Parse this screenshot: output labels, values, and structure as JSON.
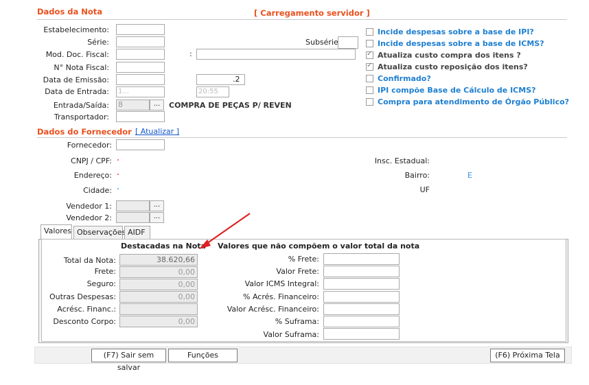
{
  "dados_nota": {
    "title": "Dados da Nota",
    "server_link": "[ Carregamento servidor ]",
    "labels": {
      "estabelecimento": "Estabelecimento:",
      "serie": "Série:",
      "subserie": "Subsérie:",
      "mod_doc": "Mod. Doc. Fiscal:",
      "nota_fiscal": "N° Nota Fiscal:",
      "data_emissao": "Data de Emissão:",
      "data_entrada": "Data de Entrada:",
      "entrada_saida": "Entrada/Saída:",
      "transportador": "Transportador:"
    },
    "values": {
      "mod_doc_sep": ":",
      "data_emissao_tail": ".2",
      "data_entrada_partial": "1...",
      "hora_entrada_partial": "20:55",
      "entrada_saida_code": "8",
      "cfop_desc": "COMPRA DE PEÇAS P/ REVEN"
    },
    "lookup_btn": "..."
  },
  "options": [
    {
      "label": "Incide despesas sobre a base de IPI?",
      "checked": false,
      "style": "blue"
    },
    {
      "label": "Incide despesas sobre a base de ICMS?",
      "checked": false,
      "style": "blue"
    },
    {
      "label": "Atualiza custo compra dos itens ?",
      "checked": true,
      "style": "dark"
    },
    {
      "label": "Atualiza custo reposição dos itens?",
      "checked": true,
      "style": "dark"
    },
    {
      "label": "Confirmado?",
      "checked": false,
      "style": "blue"
    },
    {
      "label": "IPI compõe Base de Cálculo de ICMS?",
      "checked": false,
      "style": "blue"
    },
    {
      "label": "Compra para atendimento de Órgão Público?",
      "checked": false,
      "style": "blue"
    }
  ],
  "fornecedor": {
    "title": "Dados do Fornecedor",
    "update_link": "[ Atualizar ]",
    "labels": {
      "fornecedor": "Fornecedor:",
      "cnpj": "CNPJ / CPF:",
      "endereco": "Endereço:",
      "cidade": "Cidade:",
      "vendedor1": "Vendedor 1:",
      "vendedor2": "Vendedor 2:",
      "insc_estadual": "Insc. Estadual:",
      "bairro": "Bairro:",
      "uf": "UF"
    },
    "values": {
      "bairro_tail": "E"
    }
  },
  "tabs": [
    "Valores",
    "Observações",
    "AIDF"
  ],
  "valores": {
    "destacadas_title": "Destacadas na Nota",
    "nao_compoem_title": "Valores que não compõem o valor total da nota",
    "left": [
      {
        "label": "Total da Nota:",
        "value": "38.620,66"
      },
      {
        "label": "Frete:",
        "value": "0,00"
      },
      {
        "label": "Seguro:",
        "value": "0,00"
      },
      {
        "label": "Outras Despesas:",
        "value": "0,00"
      },
      {
        "label": "Acrésc. Financ.:",
        "value": ""
      },
      {
        "label": "Desconto Corpo:",
        "value": "0,00"
      }
    ],
    "right": [
      {
        "label": "% Frete:",
        "value": ""
      },
      {
        "label": "Valor Frete:",
        "value": ""
      },
      {
        "label": "Valor ICMS Integral:",
        "value": ""
      },
      {
        "label": "% Acrés. Financeiro:",
        "value": ""
      },
      {
        "label": "Valor Acrésc. Financeiro:",
        "value": ""
      },
      {
        "label": "% Suframa:",
        "value": ""
      },
      {
        "label": "Valor Suframa:",
        "value": ""
      }
    ]
  },
  "footer": {
    "sair": "(F7) Sair sem salvar",
    "funcoes": "Funções",
    "proxima": "(F6) Próxima Tela"
  },
  "colors": {
    "section_title": "#e8501e",
    "option_blue": "#1e7fd0",
    "annotation_arrow": "#e02020"
  }
}
